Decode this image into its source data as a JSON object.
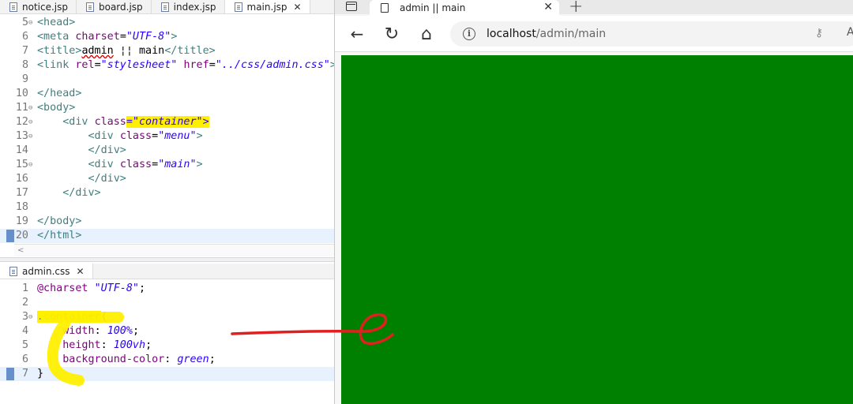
{
  "editor": {
    "top_tabs": [
      {
        "label": "notice.jsp",
        "active": false
      },
      {
        "label": "board.jsp",
        "active": false
      },
      {
        "label": "index.jsp",
        "active": false
      },
      {
        "label": "main.jsp",
        "active": true,
        "close": "✕"
      }
    ],
    "jsp_lines": [
      {
        "n": "5",
        "fold": "⊖",
        "parts": [
          [
            "tg",
            "<head>"
          ]
        ]
      },
      {
        "n": "6",
        "parts": [
          [
            "tg",
            "<meta "
          ],
          [
            "at",
            "charset"
          ],
          [
            "tx",
            "="
          ],
          [
            "av",
            "\"UTF-8\""
          ],
          [
            "tg",
            ">"
          ]
        ]
      },
      {
        "n": "7",
        "parts": [
          [
            "tg",
            "<title>"
          ],
          [
            "sq",
            "admin"
          ],
          [
            "tx",
            " ¦¦ main"
          ],
          [
            "tg",
            "</title>"
          ]
        ]
      },
      {
        "n": "8",
        "parts": [
          [
            "tg",
            "<link "
          ],
          [
            "at",
            "rel"
          ],
          [
            "tx",
            "="
          ],
          [
            "av",
            "\"stylesheet\""
          ],
          [
            "tx",
            " "
          ],
          [
            "at",
            "href"
          ],
          [
            "tx",
            "="
          ],
          [
            "av",
            "\"../css/admin.css\""
          ],
          [
            "tg",
            ">"
          ]
        ]
      },
      {
        "n": "9",
        "parts": []
      },
      {
        "n": "10",
        "parts": [
          [
            "tg",
            "</head>"
          ]
        ]
      },
      {
        "n": "11",
        "fold": "⊖",
        "parts": [
          [
            "tg",
            "<body>"
          ]
        ]
      },
      {
        "n": "12",
        "fold": "⊖",
        "parts": [
          [
            "tx",
            "    "
          ],
          [
            "tg",
            "<div "
          ],
          [
            "at",
            "class"
          ],
          [
            "hl",
            "=\"container\">"
          ]
        ]
      },
      {
        "n": "13",
        "fold": "⊖",
        "parts": [
          [
            "tx",
            "        "
          ],
          [
            "tg",
            "<div "
          ],
          [
            "at",
            "class"
          ],
          [
            "tx",
            "="
          ],
          [
            "av",
            "\"menu\""
          ],
          [
            "tg",
            ">"
          ]
        ]
      },
      {
        "n": "14",
        "parts": [
          [
            "tx",
            "        "
          ],
          [
            "tg",
            "</div>"
          ]
        ]
      },
      {
        "n": "15",
        "fold": "⊖",
        "parts": [
          [
            "tx",
            "        "
          ],
          [
            "tg",
            "<div "
          ],
          [
            "at",
            "class"
          ],
          [
            "tx",
            "="
          ],
          [
            "av",
            "\"main\""
          ],
          [
            "tg",
            ">"
          ]
        ]
      },
      {
        "n": "16",
        "parts": [
          [
            "tx",
            "        "
          ],
          [
            "tg",
            "</div>"
          ]
        ]
      },
      {
        "n": "17",
        "parts": [
          [
            "tx",
            "    "
          ],
          [
            "tg",
            "</div>"
          ]
        ]
      },
      {
        "n": "18",
        "parts": []
      },
      {
        "n": "19",
        "parts": [
          [
            "tg",
            "</body>"
          ]
        ]
      },
      {
        "n": "20",
        "current": true,
        "marker": true,
        "parts": [
          [
            "tg",
            "</html>"
          ]
        ]
      }
    ],
    "scroll_glyph": "<",
    "css_tab": {
      "label": "admin.css",
      "close": "✕"
    },
    "css_lines": [
      {
        "n": "1",
        "parts": [
          [
            "prop",
            "@charset "
          ],
          [
            "cv",
            "\"UTF-8\""
          ],
          [
            "dark",
            ";"
          ]
        ]
      },
      {
        "n": "2",
        "parts": []
      },
      {
        "n": "3",
        "fold": "⊖",
        "parts": [
          [
            "hlsel",
            ".container"
          ],
          [
            "dark",
            "{"
          ]
        ]
      },
      {
        "n": "4",
        "parts": [
          [
            "tx",
            "    "
          ],
          [
            "prop",
            "width"
          ],
          [
            "dark",
            ": "
          ],
          [
            "cv",
            "100%"
          ],
          [
            "dark",
            ";"
          ]
        ]
      },
      {
        "n": "5",
        "parts": [
          [
            "tx",
            "    "
          ],
          [
            "prop",
            "height"
          ],
          [
            "dark",
            ": "
          ],
          [
            "cv",
            "100vh"
          ],
          [
            "dark",
            ";"
          ]
        ]
      },
      {
        "n": "6",
        "parts": [
          [
            "tx",
            "    "
          ],
          [
            "prop",
            "background-color"
          ],
          [
            "dark",
            ": "
          ],
          [
            "cv",
            "green"
          ],
          [
            "dark",
            ";"
          ]
        ]
      },
      {
        "n": "7",
        "current": true,
        "marker": true,
        "parts": [
          [
            "dark",
            "}"
          ]
        ]
      }
    ]
  },
  "browser": {
    "tab_title": "admin || main",
    "tab_close": "✕",
    "new_tab": "+",
    "back": "←",
    "reload": "↻",
    "home": "⌂",
    "url_host": "localhost",
    "url_path": "/admin/main",
    "key_icon": "⚷",
    "aa": "A",
    "page_background": "#008000"
  },
  "icons": [
    "file-icon",
    "tab-strip-icon",
    "page-icon",
    "back-arrow-icon",
    "reload-icon",
    "home-icon",
    "info-icon",
    "key-icon"
  ],
  "colors": {
    "annotation_yellow": "#ffef00",
    "annotation_red": "#e02020",
    "page_green": "#008000"
  }
}
